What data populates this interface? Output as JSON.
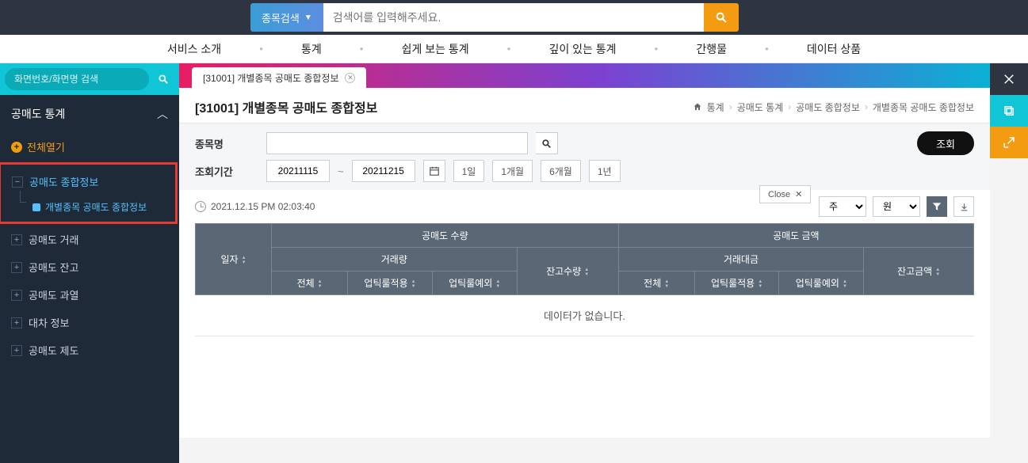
{
  "top": {
    "search_type": "종목검색",
    "placeholder": "검색어를 입력해주세요."
  },
  "nav": {
    "items": [
      "서비스 소개",
      "통계",
      "쉽게 보는 통계",
      "깊이 있는 통계",
      "간행물",
      "데이터 상품"
    ]
  },
  "side": {
    "search_placeholder": "화면번호/화면명 검색",
    "title": "공매도 통계",
    "close_handle": "Close x",
    "expand_all": "전체열기",
    "active_group": "공매도 종합정보",
    "active_item": "개별종목 공매도 종합정보",
    "nodes": [
      "공매도 거래",
      "공매도 잔고",
      "공매도 과열",
      "대차 정보",
      "공매도 제도"
    ]
  },
  "tab": {
    "label": "[31001] 개별종목 공매도 종합정보"
  },
  "page": {
    "title": "[31001] 개별종목 공매도 종합정보"
  },
  "breadcrumb": {
    "items": [
      "통계",
      "공매도 통계",
      "공매도 종합정보",
      "개별종목 공매도 종합정보"
    ]
  },
  "filter": {
    "stock_label": "종목명",
    "period_label": "조회기간",
    "date_from": "20211115",
    "date_to": "20211215",
    "ranges": [
      "1일",
      "1개월",
      "6개월",
      "1년"
    ],
    "query": "조회",
    "close_pop": "Close"
  },
  "meta": {
    "timestamp": "2021.12.15 PM 02:03:40",
    "unit1": "주",
    "unit2": "원"
  },
  "table": {
    "h_date": "일자",
    "h_qty_group": "공매도 수량",
    "h_amt_group": "공매도 금액",
    "h_vol_group": "거래량",
    "h_val_group": "거래대금",
    "h_bal_qty": "잔고수량",
    "h_bal_amt": "잔고금액",
    "h_total": "전체",
    "h_uptick": "업틱룰적용",
    "h_nouptick": "업틱룰예외",
    "nodata": "데이터가 없습니다."
  }
}
